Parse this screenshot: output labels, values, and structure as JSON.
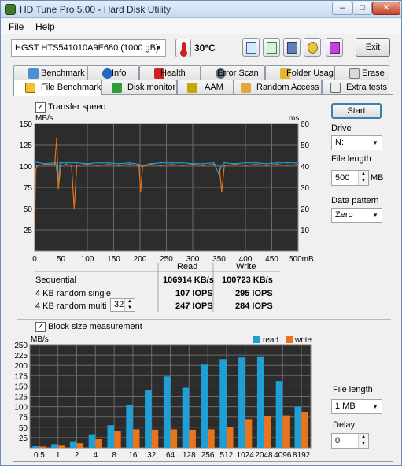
{
  "window": {
    "title": "HD Tune Pro 5.00 - Hard Disk Utility"
  },
  "menu": {
    "file": "File",
    "file_mnemonic": "F",
    "file_rest": "ile",
    "help": "Help",
    "help_mnemonic": "H",
    "help_rest": "elp"
  },
  "toolbar": {
    "drive": "HGST HTS541010A9E680    (1000 gB)",
    "temperature": "30°C",
    "exit_label": "Exit"
  },
  "tabs_back": [
    "Benchmark",
    "Info",
    "Health",
    "Error Scan",
    "Folder Usage",
    "Erase"
  ],
  "tabs_front": [
    "File Benchmark",
    "Disk monitor",
    "AAM",
    "Random Access",
    "Extra tests"
  ],
  "active_tab": "File Benchmark",
  "transfer": {
    "checkbox_label": "Transfer speed",
    "checked": true,
    "y_unit_left": "MB/s",
    "y_unit_right": "ms",
    "y_ticks_left": [
      "150",
      "125",
      "100",
      "75",
      "50",
      "25"
    ],
    "y_ticks_right": [
      "60",
      "50",
      "40",
      "30",
      "20",
      "10"
    ],
    "x_ticks": [
      "0",
      "50",
      "100",
      "150",
      "200",
      "250",
      "300",
      "350",
      "400",
      "450",
      "500mB"
    ]
  },
  "results": {
    "col_read": "Read",
    "col_write": "Write",
    "rows": [
      {
        "label": "Sequential",
        "read": "106914 KB/s",
        "write": "100723 KB/s"
      },
      {
        "label": "4 KB random single",
        "read": "107 IOPS",
        "write": "295 IOPS"
      },
      {
        "label": "4 KB random multi",
        "read": "247 IOPS",
        "write": "284 IOPS"
      }
    ],
    "queue_depth": "32"
  },
  "side": {
    "start_label": "Start",
    "drive_label": "Drive",
    "drive_value": "N:",
    "file_length_label": "File length",
    "file_length_value": "500",
    "file_length_unit": "MB",
    "data_pattern_label": "Data pattern",
    "data_pattern_value": "Zero",
    "block_file_length_label": "File length",
    "block_file_length_value": "1 MB",
    "delay_label": "Delay",
    "delay_value": "0"
  },
  "block": {
    "checkbox_label": "Block size measurement",
    "checked": true,
    "y_unit": "MB/s",
    "legend_read": "read",
    "legend_write": "write"
  },
  "colors": {
    "read": "#1e9fd6",
    "write": "#e8751d",
    "plot_bg": "#2c2c2c",
    "grid": "#6b6b6b"
  },
  "chart_data": [
    {
      "type": "line",
      "title": "Transfer speed",
      "xlabel": "mB",
      "ylabel": "MB/s",
      "xlim": [
        0,
        500
      ],
      "ylim": [
        0,
        150
      ],
      "y2lim": [
        0,
        60
      ],
      "y2label": "ms",
      "series": [
        {
          "name": "read",
          "x": [
            0,
            20,
            40,
            45,
            48,
            60,
            80,
            100,
            120,
            140,
            160,
            180,
            200,
            202,
            220,
            240,
            260,
            280,
            300,
            320,
            340,
            350,
            354,
            360,
            380,
            400,
            420,
            440,
            460,
            480,
            500
          ],
          "values": [
            105,
            103,
            104,
            80,
            104,
            104,
            104,
            103,
            104,
            104,
            103,
            104,
            102,
            100,
            103,
            104,
            104,
            104,
            103,
            103,
            104,
            90,
            100,
            104,
            103,
            104,
            104,
            103,
            104,
            104,
            104
          ]
        },
        {
          "name": "write",
          "x": [
            0,
            2,
            5,
            20,
            38,
            42,
            45,
            50,
            60,
            70,
            75,
            80,
            100,
            120,
            140,
            160,
            180,
            198,
            201,
            205,
            220,
            240,
            260,
            280,
            300,
            320,
            340,
            350,
            355,
            360,
            380,
            400,
            420,
            440,
            460,
            480,
            500
          ],
          "values": [
            25,
            95,
            101,
            102,
            102,
            133,
            74,
            101,
            102,
            101,
            50,
            101,
            102,
            101,
            102,
            101,
            102,
            101,
            70,
            100,
            102,
            101,
            102,
            101,
            102,
            101,
            102,
            101,
            70,
            101,
            102,
            101,
            102,
            101,
            102,
            101,
            102
          ]
        }
      ]
    },
    {
      "type": "bar",
      "title": "Block size measurement",
      "ylabel": "MB/s",
      "ylim": [
        0,
        250
      ],
      "yticks": [
        "250",
        "225",
        "200",
        "175",
        "150",
        "125",
        "100",
        "75",
        "50",
        "25"
      ],
      "categories": [
        "0.5",
        "1",
        "2",
        "4",
        "8",
        "16",
        "32",
        "64",
        "128",
        "256",
        "512",
        "1024",
        "2048",
        "4096",
        "8192"
      ],
      "series": [
        {
          "name": "read",
          "values": [
            4,
            9,
            16,
            33,
            55,
            103,
            141,
            173,
            146,
            202,
            215,
            219,
            222,
            162,
            100
          ]
        },
        {
          "name": "write",
          "values": [
            3,
            7,
            11,
            21,
            41,
            45,
            44,
            45,
            44,
            45,
            50,
            70,
            78,
            79,
            86
          ]
        }
      ]
    }
  ]
}
